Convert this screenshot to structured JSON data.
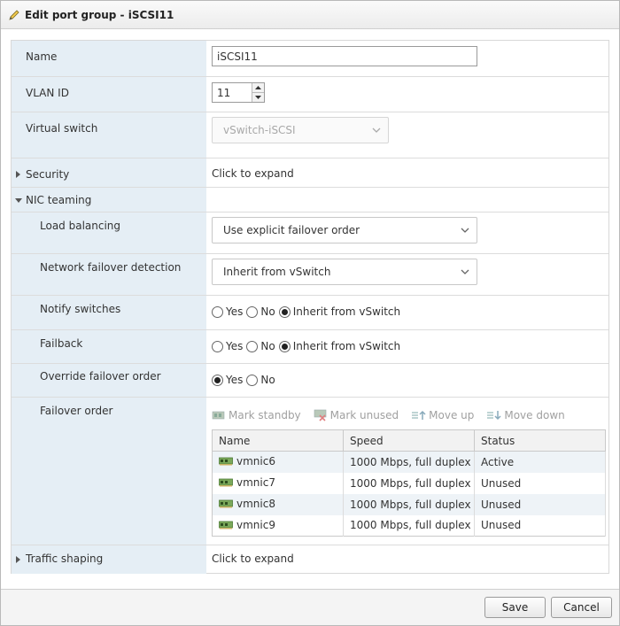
{
  "dialog": {
    "title": "Edit port group - iSCSI11"
  },
  "form": {
    "name": {
      "label": "Name",
      "value": "iSCSI11"
    },
    "vlan": {
      "label": "VLAN ID",
      "value": "11"
    },
    "vswitch": {
      "label": "Virtual switch",
      "value": "vSwitch-iSCSI"
    },
    "security": {
      "label": "Security",
      "value": "Click to expand"
    },
    "nic_teaming": {
      "label": "NIC teaming"
    },
    "load_balancing": {
      "label": "Load balancing",
      "value": "Use explicit failover order"
    },
    "failover_detection": {
      "label": "Network failover detection",
      "value": "Inherit from vSwitch"
    },
    "notify_switches": {
      "label": "Notify switches",
      "options": [
        "Yes",
        "No",
        "Inherit from vSwitch"
      ],
      "selected": "Inherit from vSwitch"
    },
    "failback": {
      "label": "Failback",
      "options": [
        "Yes",
        "No",
        "Inherit from vSwitch"
      ],
      "selected": "Inherit from vSwitch"
    },
    "override_order": {
      "label": "Override failover order",
      "options": [
        "Yes",
        "No"
      ],
      "selected": "Yes"
    },
    "failover_order": {
      "label": "Failover order",
      "toolbar": {
        "mark_standby": "Mark standby",
        "mark_unused": "Mark unused",
        "move_up": "Move up",
        "move_down": "Move down"
      },
      "columns": [
        "Name",
        "Speed",
        "Status"
      ],
      "rows": [
        {
          "name": "vmnic6",
          "speed": "1000 Mbps, full duplex",
          "status": "Active"
        },
        {
          "name": "vmnic7",
          "speed": "1000 Mbps, full duplex",
          "status": "Unused"
        },
        {
          "name": "vmnic8",
          "speed": "1000 Mbps, full duplex",
          "status": "Unused"
        },
        {
          "name": "vmnic9",
          "speed": "1000 Mbps, full duplex",
          "status": "Unused"
        }
      ]
    },
    "traffic_shaping": {
      "label": "Traffic shaping",
      "value": "Click to expand"
    }
  },
  "footer": {
    "save_label": "Save",
    "cancel_label": "Cancel"
  }
}
